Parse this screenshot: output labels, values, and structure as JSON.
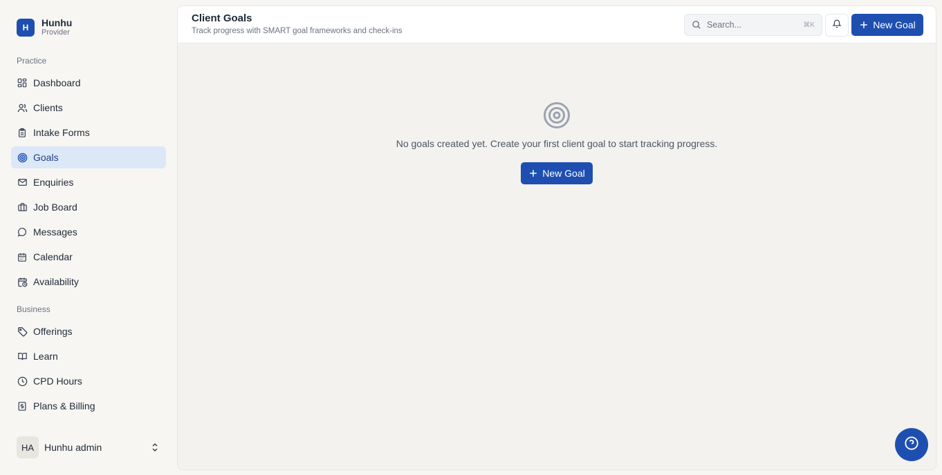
{
  "brand": {
    "logo_letter": "H",
    "name": "Hunhu",
    "subtitle": "Provider"
  },
  "sidebar": {
    "sections": [
      {
        "label": "Practice",
        "items": [
          {
            "label": "Dashboard",
            "icon": "dashboard-icon"
          },
          {
            "label": "Clients",
            "icon": "users-icon"
          },
          {
            "label": "Intake Forms",
            "icon": "clipboard-icon"
          },
          {
            "label": "Goals",
            "icon": "target-icon",
            "active": true
          },
          {
            "label": "Enquiries",
            "icon": "mail-icon"
          },
          {
            "label": "Job Board",
            "icon": "briefcase-icon"
          },
          {
            "label": "Messages",
            "icon": "chat-icon"
          },
          {
            "label": "Calendar",
            "icon": "calendar-icon"
          },
          {
            "label": "Availability",
            "icon": "calendar-clock-icon"
          }
        ]
      },
      {
        "label": "Business",
        "items": [
          {
            "label": "Offerings",
            "icon": "tag-icon"
          },
          {
            "label": "Learn",
            "icon": "book-icon"
          },
          {
            "label": "CPD Hours",
            "icon": "clock-icon"
          },
          {
            "label": "Plans & Billing",
            "icon": "receipt-icon"
          }
        ]
      }
    ],
    "user": {
      "initials": "HA",
      "name": "Hunhu admin"
    }
  },
  "header": {
    "title": "Client Goals",
    "subtitle": "Track progress with SMART goal frameworks and check-ins",
    "search_placeholder": "Search...",
    "search_shortcut": "⌘K",
    "new_button": "New Goal"
  },
  "empty_state": {
    "message": "No goals created yet. Create your first client goal to start tracking progress.",
    "button": "New Goal"
  },
  "colors": {
    "accent": "#1e4fb0",
    "active_bg": "#dce8f7",
    "background": "#f7f6f3"
  }
}
